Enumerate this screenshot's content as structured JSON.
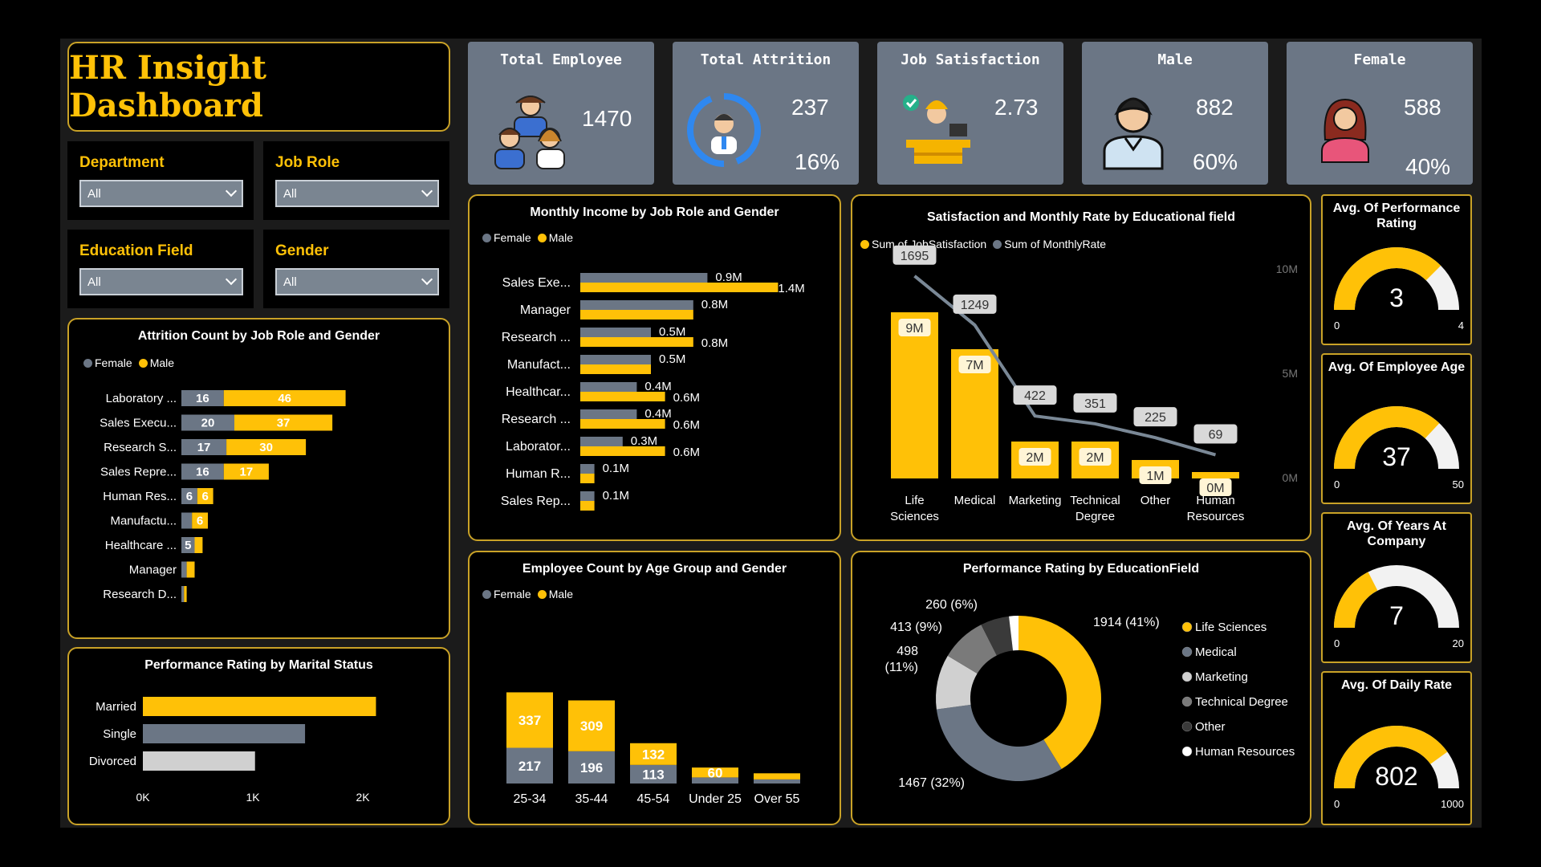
{
  "title": "HR Insight Dashboard",
  "colors": {
    "accent": "#ffc107",
    "female": "#6b7685",
    "panel_border": "#c9a227"
  },
  "slicers": [
    {
      "label": "Department",
      "value": "All"
    },
    {
      "label": "Job Role",
      "value": "All"
    },
    {
      "label": "Education Field",
      "value": "All"
    },
    {
      "label": "Gender",
      "value": "All"
    }
  ],
  "kpis": [
    {
      "title": "Total Employee",
      "value": "1470",
      "pct": "",
      "icon": "team-icon"
    },
    {
      "title": "Total Attrition",
      "value": "237",
      "pct": "16%",
      "icon": "attrition-cycle-icon"
    },
    {
      "title": "Job Satisfaction",
      "value": "2.73",
      "pct": "",
      "icon": "satisfied-worker-icon"
    },
    {
      "title": "Male",
      "value": "882",
      "pct": "60%",
      "icon": "male-person-icon"
    },
    {
      "title": "Female",
      "value": "588",
      "pct": "40%",
      "icon": "female-person-icon"
    }
  ],
  "legend": {
    "female": "Female",
    "male": "Male",
    "sum_js": "Sum of JobSatisfaction",
    "sum_mr": "Sum of MonthlyRate"
  },
  "chart_data": [
    {
      "id": "attrition",
      "type": "bar",
      "title": "Attrition Count by Job Role and Gender",
      "categories": [
        "Laboratory ...",
        "Sales Execu...",
        "Research S...",
        "Sales Repre...",
        "Human Res...",
        "Manufactu...",
        "Healthcare ...",
        "Manager",
        "Research D..."
      ],
      "series": [
        {
          "name": "Female",
          "values": [
            16,
            20,
            17,
            16,
            6,
            4,
            5,
            2,
            1
          ]
        },
        {
          "name": "Male",
          "values": [
            46,
            37,
            30,
            17,
            6,
            6,
            3,
            3,
            1
          ]
        }
      ]
    },
    {
      "id": "marital",
      "type": "bar",
      "title": "Performance Rating by Marital Status",
      "categories": [
        "Married",
        "Single",
        "Divorced"
      ],
      "values": [
        2120,
        1475,
        1020
      ],
      "xticks": [
        "0K",
        "1K",
        "2K"
      ]
    },
    {
      "id": "income",
      "type": "bar",
      "title": "Monthly Income by Job Role and Gender",
      "categories": [
        "Sales Exe...",
        "Manager",
        "Research ...",
        "Manufact...",
        "Healthcar...",
        "Research ...",
        "Laborator...",
        "Human R...",
        "Sales Rep..."
      ],
      "series": [
        {
          "name": "Female",
          "values": [
            0.9,
            0.8,
            0.5,
            0.5,
            0.4,
            0.4,
            0.3,
            0.1,
            0.1
          ],
          "labels": [
            "0.9M",
            "0.8M",
            "0.5M",
            "0.5M",
            "0.4M",
            "0.4M",
            "0.3M",
            "0.1M",
            "0.1M"
          ]
        },
        {
          "name": "Male",
          "values": [
            1.4,
            0.8,
            0.8,
            0.5,
            0.6,
            0.6,
            0.6,
            0.1,
            0.1
          ],
          "labels": [
            "1.4M",
            "",
            "0.8M",
            "",
            "0.6M",
            "0.6M",
            "0.6M",
            "",
            ""
          ]
        }
      ]
    },
    {
      "id": "satisfaction",
      "type": "bar",
      "title": "Satisfaction and Monthly Rate by Educational field",
      "categories": [
        "Life Sciences",
        "Medical",
        "Marketing",
        "Technical Degree",
        "Other",
        "Human Resources"
      ],
      "series": [
        {
          "name": "Sum of JobSatisfaction",
          "values": [
            9,
            7,
            2,
            2,
            1,
            0
          ],
          "labels": [
            "9M",
            "7M",
            "2M",
            "2M",
            "1M",
            "0M"
          ]
        },
        {
          "name": "Sum of MonthlyRate",
          "values": [
            1695,
            1249,
            422,
            351,
            225,
            69
          ]
        }
      ],
      "yticks": [
        "10M",
        "5M",
        "0M"
      ]
    },
    {
      "id": "age",
      "type": "bar",
      "title": "Employee Count by Age Group and Gender",
      "categories": [
        "25-34",
        "35-44",
        "45-54",
        "Under 25",
        "Over 55"
      ],
      "series": [
        {
          "name": "Female",
          "values": [
            217,
            196,
            113,
            37,
            25
          ],
          "labels": [
            "217",
            "196",
            "113",
            "",
            ""
          ]
        },
        {
          "name": "Male",
          "values": [
            337,
            309,
            132,
            60,
            37
          ],
          "labels": [
            "337",
            "309",
            "132",
            "60",
            ""
          ]
        }
      ]
    },
    {
      "id": "perf",
      "type": "pie",
      "title": "Performance Rating by EducationField",
      "categories": [
        "Life Sciences",
        "Medical",
        "Marketing",
        "Technical Degree",
        "Other",
        "Human Resources"
      ],
      "values": [
        1914,
        1467,
        498,
        413,
        260,
        86
      ],
      "labels": [
        "1914 (41%)",
        "1467 (32%)",
        "498 (11%)",
        "413 (9%)",
        "260 (6%)",
        ""
      ],
      "colors": [
        "#ffc107",
        "#6b7685",
        "#d0d0d0",
        "#7a7a7a",
        "#3a3a3a",
        "#ffffff"
      ]
    }
  ],
  "gauges": [
    {
      "title": "Avg. Of Performance Rating",
      "value": 3,
      "min": "0",
      "max": "4",
      "display": "3"
    },
    {
      "title": "Avg. Of Employee Age",
      "value": 37,
      "min": "0",
      "max": "50",
      "display": "37"
    },
    {
      "title": "Avg. Of Years At Company",
      "value": 7,
      "min": "0",
      "max": "20",
      "display": "7"
    },
    {
      "title": "Avg. Of Daily Rate",
      "value": 802,
      "min": "0",
      "max": "1000",
      "display": "802"
    }
  ]
}
